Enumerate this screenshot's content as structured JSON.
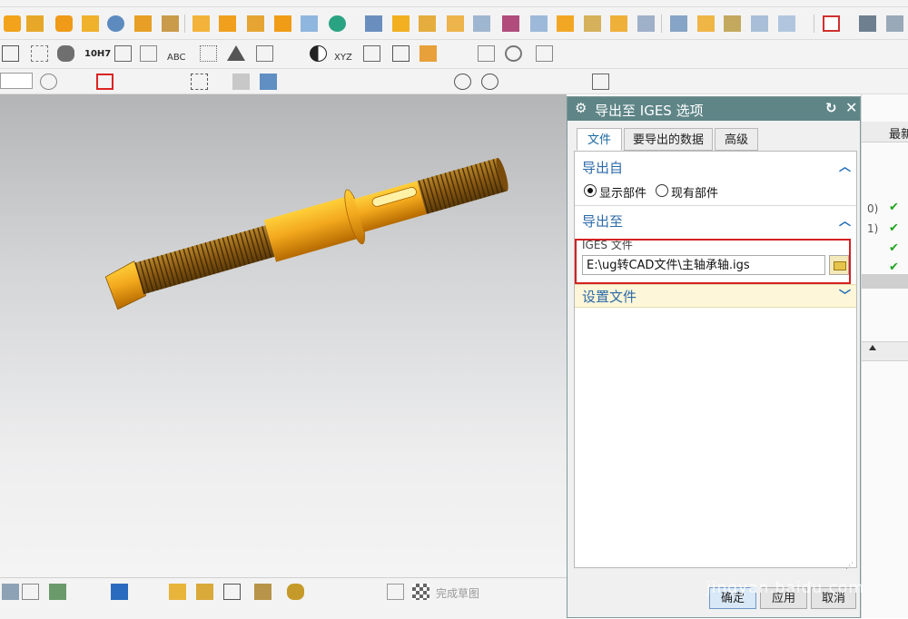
{
  "dialog": {
    "title": "导出至 IGES 选项",
    "tabs": [
      {
        "label": "文件"
      },
      {
        "label": "要导出的数据"
      },
      {
        "label": "高级"
      }
    ],
    "export_from": {
      "title": "导出自",
      "options": [
        {
          "label": "显示部件",
          "checked": true
        },
        {
          "label": "现有部件",
          "checked": false
        }
      ]
    },
    "export_to": {
      "title": "导出至",
      "field_label": "IGES 文件",
      "file_path": "E:\\ug转CAD文件\\主轴承轴.igs"
    },
    "settings_file": {
      "title": "设置文件"
    },
    "buttons": {
      "ok": "确定",
      "apply": "应用",
      "cancel": "取消"
    }
  },
  "right_panel": {
    "header": "最新",
    "rows": [
      "0)",
      "1)"
    ]
  },
  "toolbar": {
    "tolerance_label": "10H7",
    "abc_label": "ABC",
    "xyz_label": "XYZ",
    "finish_sketch": "完成草图"
  },
  "watermark": "jingyan.baidu.com",
  "colors": {
    "dialog_title_bg": "#5f8587",
    "section_title": "#2c6aa8",
    "highlight_box": "#d42121",
    "part_orange": "#f3a81d"
  }
}
